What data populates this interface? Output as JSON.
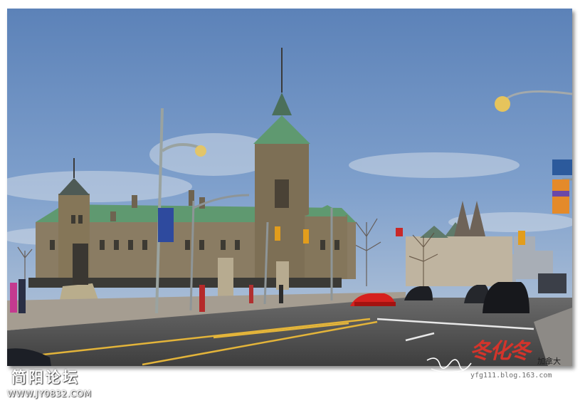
{
  "image": {
    "subject": "Parliament Hill East Block, Ottawa, street scene",
    "sky_color": "#6f93c4",
    "stone_color": "#8a7c63",
    "roof_color": "#5f9970",
    "road_color": "#545454",
    "road_marking_color": "#e3b43a"
  },
  "watermark": {
    "forum_logo": "简阳论坛",
    "forum_url": "WWW.JY0832.COM",
    "signature_red": "冬化冬",
    "signature_location": "加拿大",
    "blog_url": "yfg111.blog.163.com"
  }
}
